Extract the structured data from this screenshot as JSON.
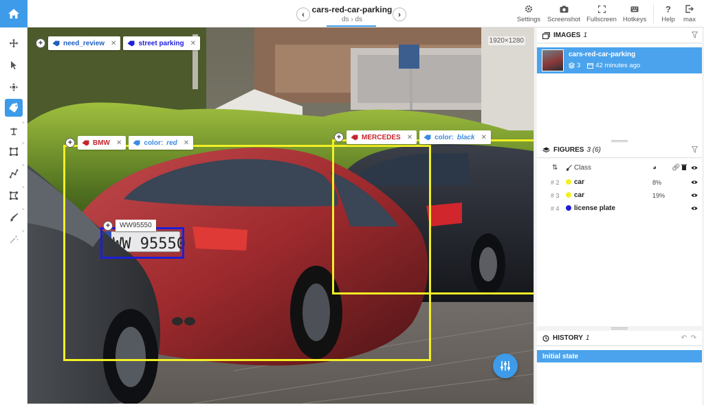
{
  "header": {
    "title": "cars-red-car-parking",
    "breadcrumb_left": "ds",
    "breadcrumb_sep": "›",
    "breadcrumb_right": "ds",
    "buttons": {
      "settings": "Settings",
      "screenshot": "Screenshot",
      "fullscreen": "Fullscreen",
      "hotkeys": "Hotkeys",
      "help": "Help",
      "max": "max"
    }
  },
  "canvas": {
    "resolution": "1920×1280",
    "image_tags": [
      {
        "label": "need_review",
        "color": "#1f5fbf"
      },
      {
        "label": "street parking",
        "color": "#1d1ed9"
      }
    ],
    "objects": [
      {
        "name": "BMW",
        "attr_key": "color:",
        "attr_value": "red"
      },
      {
        "name": "MERCEDES",
        "attr_key": "color:",
        "attr_value": "black"
      }
    ],
    "plate_text": "WW95550",
    "plate_image_text": "WW 95550"
  },
  "images_panel": {
    "title": "IMAGES",
    "count": "1",
    "item": {
      "name": "cars-red-car-parking",
      "layers": "3",
      "time": "42 minutes ago"
    }
  },
  "figures_panel": {
    "title": "FIGURES",
    "count": "3 (6)",
    "column_class": "Class",
    "rows": [
      {
        "num": "# 2",
        "cls": "car",
        "color": "#f2f025",
        "pct": "8%"
      },
      {
        "num": "# 3",
        "cls": "car",
        "color": "#f2f025",
        "pct": "19%"
      },
      {
        "num": "# 4",
        "cls": "license plate",
        "color": "#1d1ed9",
        "pct": ""
      }
    ]
  },
  "history_panel": {
    "title": "HISTORY",
    "count": "1",
    "item": "Initial state"
  },
  "icons": [
    "home-icon",
    "chevron-left-icon",
    "chevron-right-icon",
    "gear-icon",
    "camera-icon",
    "fullscreen-icon",
    "keyboard-icon",
    "help-icon",
    "logout-icon",
    "move-icon",
    "pointer-icon",
    "drag-icon",
    "tag-icon",
    "point-icon",
    "rectangle-icon",
    "polyline-icon",
    "polygon-icon",
    "brush-icon",
    "magic-wand-icon",
    "sliders-icon",
    "filter-icon",
    "layers-icon",
    "calendar-icon",
    "eye-icon",
    "link-icon",
    "trash-icon",
    "history-icon",
    "undo-icon",
    "redo-icon"
  ]
}
